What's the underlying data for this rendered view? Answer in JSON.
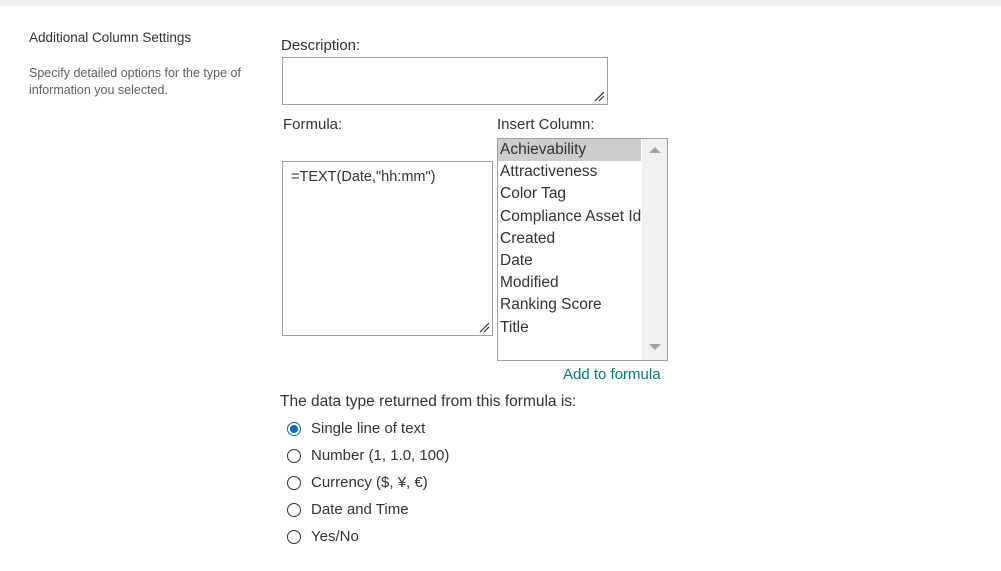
{
  "section": {
    "title": "Additional Column Settings",
    "description": "Specify detailed options for the type of information you selected."
  },
  "description_field": {
    "label": "Description:",
    "value": ""
  },
  "formula_field": {
    "label": "Formula:",
    "value": "=TEXT(Date,\"hh:mm\")"
  },
  "insert_column": {
    "label": "Insert Column:",
    "items": [
      "Achievability",
      "Attractiveness",
      "Color Tag",
      "Compliance Asset Id",
      "Created",
      "Date",
      "Modified",
      "Ranking Score",
      "Title"
    ],
    "selected": "Achievability",
    "add_link": "Add to formula"
  },
  "return_type": {
    "label": "The data type returned from this formula is:",
    "options": [
      {
        "label": "Single line of text",
        "checked": true
      },
      {
        "label": "Number (1, 1.0, 100)",
        "checked": false
      },
      {
        "label": "Currency ($, ¥, €)",
        "checked": false
      },
      {
        "label": "Date and Time",
        "checked": false
      },
      {
        "label": "Yes/No",
        "checked": false
      }
    ]
  },
  "colors": {
    "link": "#03787c",
    "radio_accent": "#0f6cbd",
    "selected_item_bg": "#cdcdcd"
  }
}
